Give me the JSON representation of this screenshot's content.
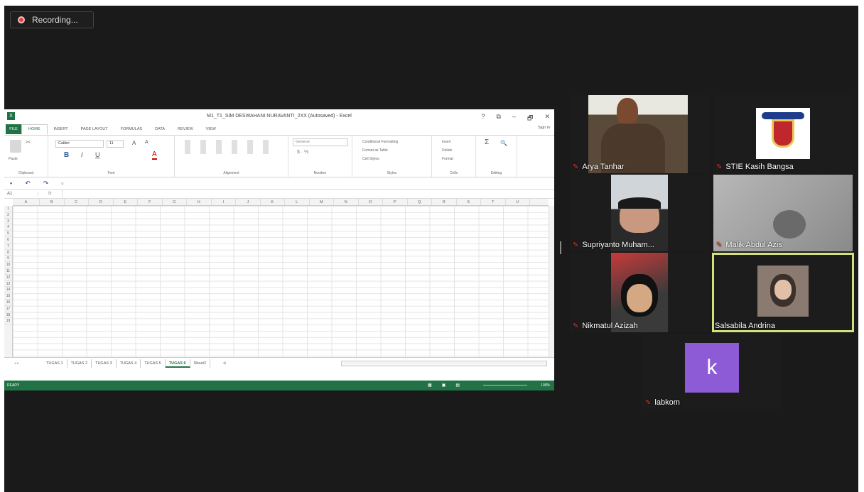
{
  "recording": {
    "label": "Recording..."
  },
  "excel": {
    "title": "M1_T1_SIM DESWAHANI NURAVANTI_2XX (Autosaved) - Excel",
    "window_controls": [
      "?",
      "⧉",
      "–",
      "🗗",
      "✕"
    ],
    "sign_in": "Sign in",
    "tabs": [
      "FILE",
      "HOME",
      "INSERT",
      "PAGE LAYOUT",
      "FORMULAS",
      "DATA",
      "REVIEW",
      "VIEW"
    ],
    "active_tab": "HOME",
    "ribbon_groups": [
      "Clipboard",
      "Font",
      "Alignment",
      "Number",
      "Styles",
      "Cells",
      "Editing"
    ],
    "font_name": "Calibri",
    "font_size": "11",
    "number_format": "General",
    "styles_items": [
      "Conditional Formatting",
      "Format as Table",
      "Cell Styles"
    ],
    "cells_items": [
      "Insert",
      "Delete",
      "Format"
    ],
    "paste_label": "Paste",
    "name_box": "A1",
    "fx": "fx",
    "columns": [
      "A",
      "B",
      "C",
      "D",
      "E",
      "F",
      "G",
      "H",
      "I",
      "J",
      "K",
      "L",
      "M",
      "N",
      "O",
      "P",
      "Q",
      "R",
      "S",
      "T",
      "U"
    ],
    "rows": [
      "1",
      "2",
      "3",
      "4",
      "5",
      "6",
      "7",
      "8",
      "9",
      "10",
      "11",
      "12",
      "13",
      "14",
      "15",
      "16",
      "17",
      "18",
      "19"
    ],
    "sheets": [
      "TUGAS 1",
      "TUGAS 2",
      "TUGAS 3",
      "TUGAS 4",
      "TUGAS 5",
      "TUGAS 6",
      "Sheet2"
    ],
    "active_sheet": "TUGAS 6",
    "status": "READY",
    "zoom": "100%"
  },
  "participants": [
    {
      "name": "Arya Tanhar",
      "muted": true
    },
    {
      "name": "STIE Kasih Bangsa",
      "muted": true
    },
    {
      "name": "Supriyanto Muham...",
      "muted": true
    },
    {
      "name": "Malik Abdul Azis",
      "muted": true
    },
    {
      "name": "Nikmatul Azizah",
      "muted": true
    },
    {
      "name": "Salsabila Andrina",
      "muted": false,
      "active_speaker": true
    },
    {
      "name": "labkom",
      "muted": true,
      "avatar_letter": "k",
      "avatar_color": "#8e5bd6"
    }
  ]
}
